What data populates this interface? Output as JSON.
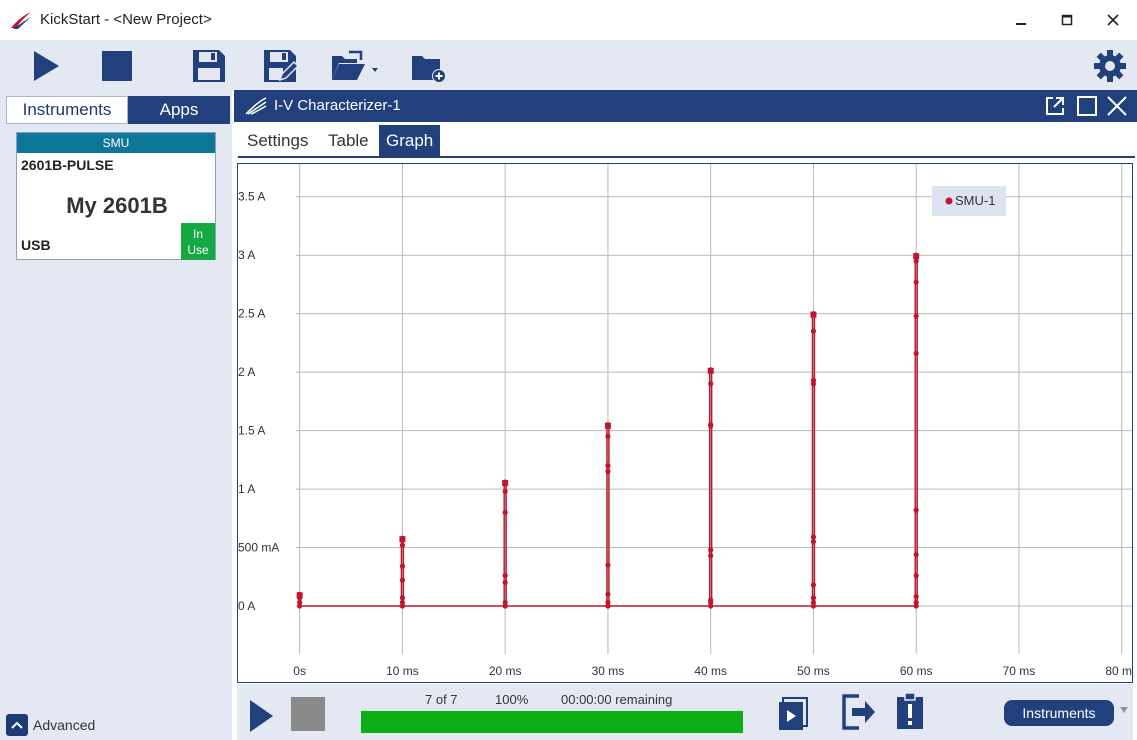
{
  "window": {
    "title": "KickStart - <New Project>"
  },
  "left_panel": {
    "tabs": [
      {
        "label": "Instruments",
        "active": true
      },
      {
        "label": "Apps",
        "active": false
      }
    ],
    "instrument": {
      "type": "SMU",
      "model": "2601B-PULSE",
      "name": "My 2601B",
      "connection": "USB",
      "status": "In Use"
    },
    "advanced_label": "Advanced"
  },
  "document": {
    "title": "I-V Characterizer-1",
    "tabs": [
      {
        "label": "Settings"
      },
      {
        "label": "Table"
      },
      {
        "label": "Graph",
        "active": true
      }
    ]
  },
  "bottom_bar": {
    "count": "7 of 7",
    "percent": "100%",
    "remaining": "00:00:00 remaining",
    "progress": 1.0,
    "instruments_button": "Instruments"
  },
  "colors": {
    "accent": "#22407c",
    "series": "#c0152b",
    "progress": "#0cad14",
    "in_use": "#16a843",
    "card_header": "#0e7696"
  },
  "chart_data": {
    "type": "line",
    "xlabel": "",
    "ylabel": "",
    "x_ticks": [
      "0s",
      "10 ms",
      "20 ms",
      "30 ms",
      "40 ms",
      "50 ms",
      "60 ms",
      "70 ms",
      "80 ms"
    ],
    "y_ticks": [
      "0 A",
      "500 mA",
      "1 A",
      "1.5 A",
      "2 A",
      "2.5 A",
      "3 A",
      "3.5 A"
    ],
    "xlim_ms": [
      -6,
      81
    ],
    "ylim_A": [
      -0.65,
      3.78
    ],
    "grid": true,
    "legend_position": "top-right",
    "series": [
      {
        "name": "SMU-1",
        "pulses": [
          {
            "t_ms": 0,
            "peak_A": 0.1,
            "samples_A": [
              0,
              0.03,
              0.07,
              0.1
            ]
          },
          {
            "t_ms": 10,
            "peak_A": 0.58,
            "samples_A": [
              0,
              0.03,
              0.07,
              0.22,
              0.34,
              0.52,
              0.58
            ]
          },
          {
            "t_ms": 20,
            "peak_A": 1.06,
            "samples_A": [
              0,
              0.03,
              0.2,
              0.26,
              0.8,
              0.98,
              1.06
            ]
          },
          {
            "t_ms": 30,
            "peak_A": 1.55,
            "samples_A": [
              0,
              0.03,
              0.1,
              0.35,
              1.15,
              1.2,
              1.45,
              1.55
            ]
          },
          {
            "t_ms": 40,
            "peak_A": 2.02,
            "samples_A": [
              0,
              0.03,
              0.05,
              0.43,
              0.48,
              1.54,
              1.55,
              1.9,
              2.02
            ]
          },
          {
            "t_ms": 50,
            "peak_A": 2.5,
            "samples_A": [
              0,
              0.03,
              0.07,
              0.18,
              0.55,
              0.59,
              1.9,
              1.93,
              2.35,
              2.5
            ]
          },
          {
            "t_ms": 60,
            "peak_A": 3.0,
            "samples_A": [
              0,
              0.03,
              0.08,
              0.26,
              0.44,
              0.82,
              2.16,
              2.48,
              2.77,
              2.95,
              3.0
            ]
          }
        ]
      }
    ]
  }
}
